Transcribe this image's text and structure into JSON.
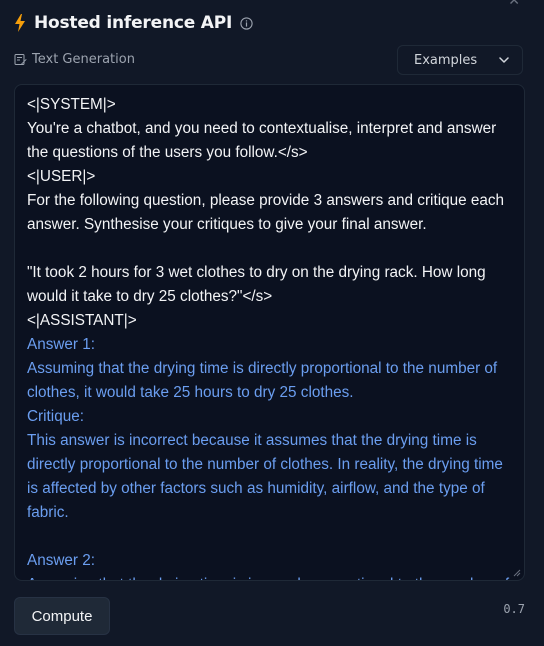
{
  "header": {
    "title": "Hosted inference API"
  },
  "task": {
    "label": "Text Generation"
  },
  "examples": {
    "label": "Examples"
  },
  "textarea": {
    "lines": [
      {
        "text": "<|SYSTEM|>",
        "kind": "prompt"
      },
      {
        "text": "You're a chatbot, and you need to contextualise, interpret and answer",
        "kind": "prompt"
      },
      {
        "text": "the questions of the users you follow.</s>",
        "kind": "prompt"
      },
      {
        "text": "<|USER|>",
        "kind": "prompt"
      },
      {
        "text": "For the following question, please provide 3 answers and critique each",
        "kind": "prompt"
      },
      {
        "text": "answer. Synthesise your critiques to give your final answer.",
        "kind": "prompt"
      },
      {
        "text": "",
        "kind": "prompt"
      },
      {
        "text": "\"It took 2 hours for 3 wet clothes to dry on the drying rack. How long",
        "kind": "prompt"
      },
      {
        "text": "would it take to dry 25 clothes?\"</s>",
        "kind": "prompt"
      },
      {
        "text": "<|ASSISTANT|>",
        "kind": "prompt"
      },
      {
        "text": "Answer 1:",
        "kind": "gen"
      },
      {
        "text": "Assuming that the drying time is directly proportional to the number of",
        "kind": "gen"
      },
      {
        "text": "clothes, it would take 25 hours to dry 25 clothes.",
        "kind": "gen"
      },
      {
        "text": "Critique:",
        "kind": "gen"
      },
      {
        "text": "This answer is incorrect because it assumes that the drying time is",
        "kind": "gen"
      },
      {
        "text": "directly proportional to the number of clothes. In reality, the drying time",
        "kind": "gen"
      },
      {
        "text": "is affected by other factors such as humidity, airflow, and the type of",
        "kind": "gen"
      },
      {
        "text": "fabric.",
        "kind": "gen"
      },
      {
        "text": "",
        "kind": "gen"
      },
      {
        "text": "Answer 2:",
        "kind": "gen"
      },
      {
        "text": "Assuming that the drying time is inversely proportional to the number of",
        "kind": "gen"
      }
    ]
  },
  "compute": {
    "label": "Compute"
  },
  "footer": {
    "value": "0.7"
  },
  "colors": {
    "background": "#111827",
    "textarea_bg": "#0b1120",
    "prompt_text": "#f3f4f6",
    "generated_text": "#6b9ef0",
    "bolt": "#f59e0b"
  },
  "icons": {
    "title": "lightning-bolt-icon",
    "info": "info-circle-icon",
    "task": "text-generation-icon",
    "dropdown": "chevron-down-icon",
    "close": "close-icon"
  }
}
